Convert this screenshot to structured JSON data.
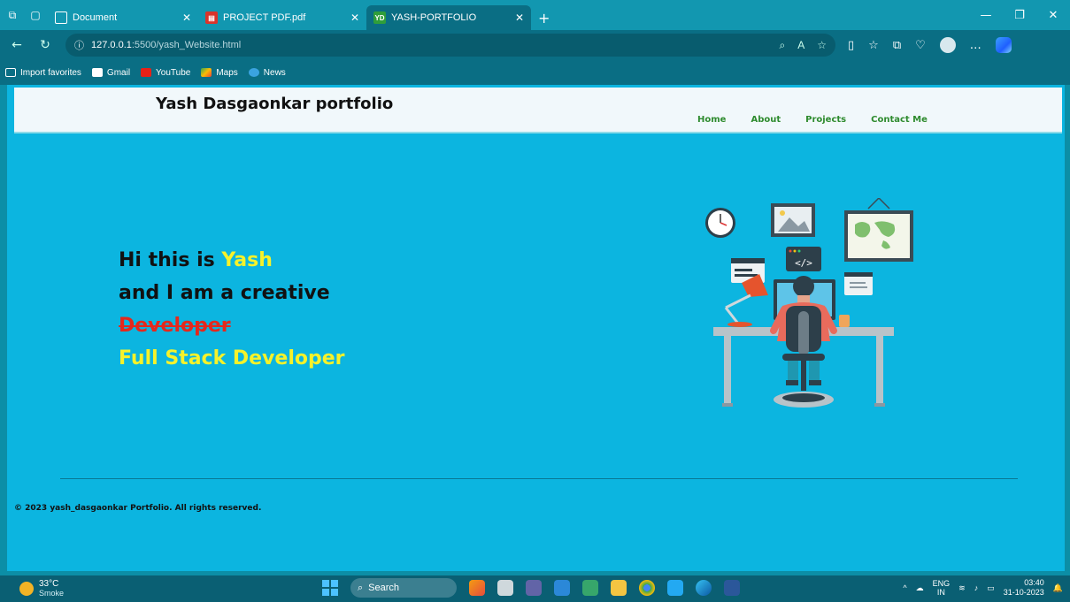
{
  "browser": {
    "tabs": [
      {
        "title": "Document",
        "favicon": "page-icon"
      },
      {
        "title": "PROJECT PDF.pdf",
        "favicon": "pdf-icon"
      },
      {
        "title": "YASH-PORTFOLIO",
        "favicon": "yd-icon",
        "favicon_text": "YD",
        "active": true
      }
    ],
    "new_tab": "+",
    "url_host": "127.0.0.1",
    "url_rest": ":5500/yash_Website.html",
    "favorites": [
      {
        "label": "Import favorites",
        "icon": "import-icon"
      },
      {
        "label": "Gmail",
        "icon": "gmail-icon"
      },
      {
        "label": "YouTube",
        "icon": "youtube-icon"
      },
      {
        "label": "Maps",
        "icon": "maps-icon"
      },
      {
        "label": "News",
        "icon": "news-icon"
      }
    ]
  },
  "site": {
    "title": "Yash Dasgaonkar portfolio",
    "nav": [
      "Home",
      "About",
      "Projects",
      "Contact Me"
    ],
    "hero": {
      "greeting": "Hi this is ",
      "name": "Yash",
      "line2": "and I am a creative",
      "struck_role": "Developer",
      "role": "Full Stack Developer"
    },
    "footer": "© 2023 yash_dasgaonkar Portfolio. All rights reserved."
  },
  "taskbar": {
    "temperature": "33°C",
    "condition": "Smoke",
    "search_label": "Search",
    "lang_top": "ENG",
    "lang_bottom": "IN",
    "time": "03:40",
    "date": "31-10-2023"
  },
  "colors": {
    "viewport_bg": "#0cb5e0",
    "highlight": "#f6f22a",
    "strike": "#e5281d",
    "nav_link": "#2e8b2e"
  }
}
